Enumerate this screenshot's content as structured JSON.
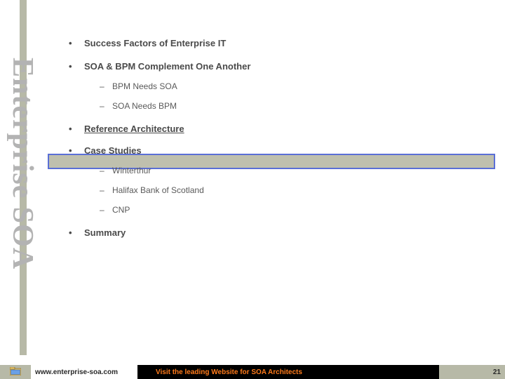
{
  "sidebar": {
    "title": "Enterprise SOA"
  },
  "outline": {
    "items": [
      {
        "label": "Success Factors of Enterprise IT",
        "sub": []
      },
      {
        "label": "SOA & BPM Complement One Another",
        "sub": [
          "BPM Needs SOA",
          "SOA Needs BPM"
        ]
      },
      {
        "label": "Reference Architecture",
        "sub": [],
        "highlighted": true
      },
      {
        "label": "Case Studies",
        "sub": [
          "Winterthur",
          "Halifax Bank of Scotland",
          "CNP"
        ]
      },
      {
        "label": "Summary",
        "sub": []
      }
    ]
  },
  "footer": {
    "url": "www.enterprise-soa.com",
    "tagline": "Visit the leading Website for SOA Architects",
    "page_number": "21"
  }
}
